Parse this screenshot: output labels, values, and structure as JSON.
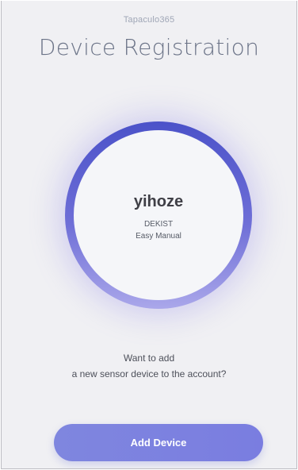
{
  "app": {
    "name": "Tapaculo365"
  },
  "header": {
    "title": "Device Registration"
  },
  "device": {
    "name": "yihoze",
    "brand": "DEKIST",
    "mode": "Easy Manual"
  },
  "prompt": {
    "line1": "Want to add",
    "line2": "a new sensor device to the account?"
  },
  "actions": {
    "add_device_label": "Add Device"
  },
  "colors": {
    "accent": "#7a7de0",
    "ring_top": "#4b52c9",
    "ring_bottom": "#aaa7ea",
    "background": "#f0f0f3"
  }
}
